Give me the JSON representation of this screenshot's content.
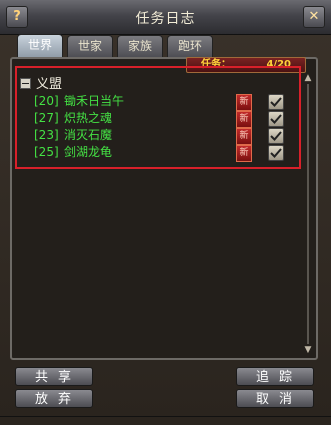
{
  "window": {
    "title": "任务日志",
    "help_label": "?",
    "close_label": "✕"
  },
  "tabs": [
    {
      "label": "世界",
      "active": true
    },
    {
      "label": "世家",
      "active": false
    },
    {
      "label": "家族",
      "active": false
    },
    {
      "label": "跑环",
      "active": false
    }
  ],
  "quest_counter": {
    "label": "任务：",
    "value": "4/20"
  },
  "group": {
    "name": "义盟",
    "toggle": "−"
  },
  "quests": [
    {
      "level": "[20]",
      "name": "锄禾日当午",
      "badge": "新",
      "tracked": true
    },
    {
      "level": "[27]",
      "name": "炽热之魂",
      "badge": "新",
      "tracked": true
    },
    {
      "level": "[23]",
      "name": "消灭石魔",
      "badge": "新",
      "tracked": true
    },
    {
      "level": "[25]",
      "name": "剑湖龙龟",
      "badge": "新",
      "tracked": true
    }
  ],
  "buttons": {
    "share": "共享",
    "abandon": "放弃",
    "track": "追踪",
    "cancel": "取消"
  },
  "colors": {
    "quest_text": "#44e244",
    "highlight_border": "#d8202a",
    "counter_text": "#ffd23a"
  }
}
